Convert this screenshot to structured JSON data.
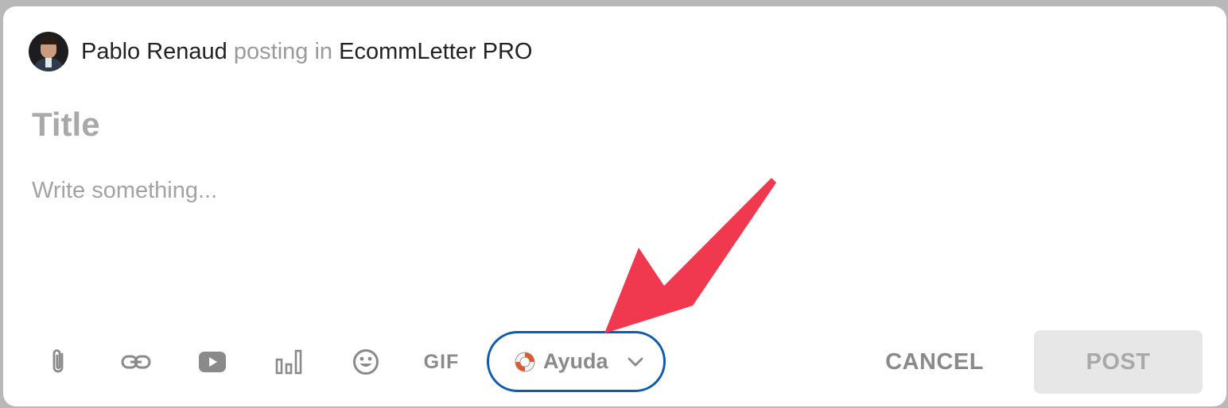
{
  "header": {
    "author": "Pablo Renaud",
    "posting_in": "posting in",
    "group": "EcommLetter PRO"
  },
  "composer": {
    "title_placeholder": "Title",
    "body_placeholder": "Write something..."
  },
  "toolbar": {
    "icons": [
      "paperclip-icon",
      "link-icon",
      "youtube-icon",
      "poll-chart-icon",
      "emoji-icon"
    ],
    "gif_label": "GIF",
    "category_label": "Ayuda",
    "category_icon": "lifebuoy-icon",
    "cancel_label": "CANCEL",
    "post_label": "POST"
  },
  "colors": {
    "highlight_border": "#0f5bb0",
    "annotation_arrow": "#f0384f",
    "post_disabled_bg": "#e7e7e7"
  }
}
